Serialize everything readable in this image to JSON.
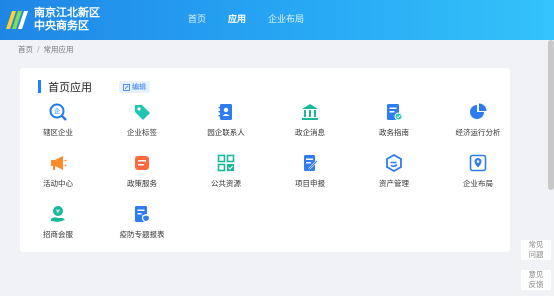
{
  "header": {
    "brand_line1": "南京江北新区",
    "brand_line2": "中央商务区",
    "nav": [
      {
        "label": "首页",
        "active": false
      },
      {
        "label": "应用",
        "active": true
      },
      {
        "label": "企业布局",
        "active": false
      }
    ]
  },
  "breadcrumb": {
    "home": "首页",
    "separator": "/",
    "current": "常用应用"
  },
  "card": {
    "title": "首页应用",
    "edit_label": "编辑"
  },
  "apps": [
    {
      "label": "辖区企业",
      "icon": "enterprise-icon",
      "color": "#1f7cf0"
    },
    {
      "label": "企业标签",
      "icon": "tag-icon",
      "color": "#1fc6b4"
    },
    {
      "label": "园企联系人",
      "icon": "contacts-icon",
      "color": "#2f7cf0"
    },
    {
      "label": "政企消息",
      "icon": "government-icon",
      "color": "#19b89a"
    },
    {
      "label": "政务指南",
      "icon": "guide-icon",
      "color": "#2f7cf0"
    },
    {
      "label": "经济运行分析",
      "icon": "pie-chart-icon",
      "color": "#2f7cf0"
    },
    {
      "label": "活动中心",
      "icon": "megaphone-icon",
      "color": "#ff8a2b"
    },
    {
      "label": "政策服务",
      "icon": "policy-icon",
      "color": "#ff6a3d"
    },
    {
      "label": "公共资源",
      "icon": "grid-icon",
      "color": "#19b89a"
    },
    {
      "label": "项目申报",
      "icon": "edit-doc-icon",
      "color": "#2f7cf0"
    },
    {
      "label": "资产管理",
      "icon": "asset-icon",
      "color": "#2f7cf0"
    },
    {
      "label": "企业布局",
      "icon": "map-icon",
      "color": "#2f7cf0"
    },
    {
      "label": "招商会服",
      "icon": "investment-icon",
      "color": "#19b89a"
    },
    {
      "label": "疫防专题报表",
      "icon": "report-icon",
      "color": "#2f7cf0"
    }
  ],
  "side_widgets": [
    {
      "line1": "常见",
      "line2": "问题"
    },
    {
      "line1": "意见",
      "line2": "反馈"
    }
  ],
  "colors": {
    "accent": "#1e80ff",
    "header_start": "#1f86e6",
    "header_end": "#34c3fa"
  }
}
